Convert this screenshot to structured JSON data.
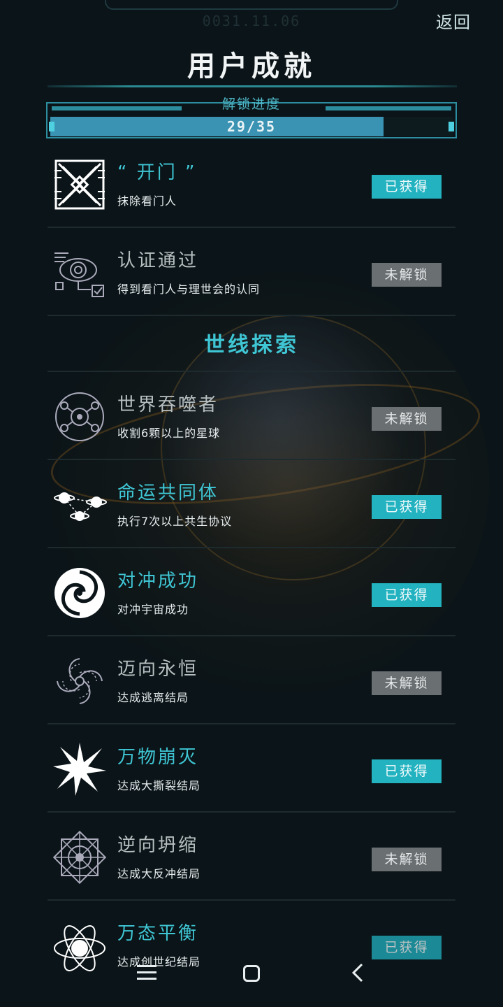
{
  "header": {
    "date": "0031.11.06",
    "back_label": "返回",
    "title": "用户成就"
  },
  "progress": {
    "label": "解锁进度",
    "text": "29/35",
    "unlocked": 29,
    "total": 35
  },
  "colors": {
    "accent": "#3fc6d4",
    "badge_got": "#22b2c0",
    "badge_locked": "#6a6f71",
    "background": "#0b1418"
  },
  "achievements_top": [
    {
      "name": "“ 开门 ”",
      "desc": "抹除看门人",
      "status": "已获得",
      "icon": "gate-icon"
    },
    {
      "name": "认证通过",
      "desc": "得到看门人与理世会的认同",
      "status": "未解锁",
      "icon": "eye-verify-icon"
    }
  ],
  "section": {
    "title": "世线探索"
  },
  "achievements": [
    {
      "name": "世界吞噬者",
      "desc": "收割6颗以上的星球",
      "status": "未解锁",
      "icon": "planet-devourer-icon"
    },
    {
      "name": "命运共同体",
      "desc": "执行7次以上共生协议",
      "status": "已获得",
      "icon": "linked-planets-icon"
    },
    {
      "name": "对冲成功",
      "desc": "对冲宇宙成功",
      "status": "已获得",
      "icon": "vortex-icon"
    },
    {
      "name": "迈向永恒",
      "desc": "达成逃离结局",
      "status": "未解锁",
      "icon": "spiral-galaxy-icon"
    },
    {
      "name": "万物崩灭",
      "desc": "达成大撕裂结局",
      "status": "已获得",
      "icon": "burst-icon"
    },
    {
      "name": "逆向坍缩",
      "desc": "达成大反冲结局",
      "status": "未解锁",
      "icon": "mandala-icon"
    },
    {
      "name": "万态平衡",
      "desc": "达成创世纪结局",
      "status": "已获得",
      "icon": "orbit-atom-icon"
    }
  ],
  "navbar": {
    "menu_icon": "menu-icon",
    "home_icon": "home-icon",
    "back_icon": "back-arrow-icon"
  }
}
